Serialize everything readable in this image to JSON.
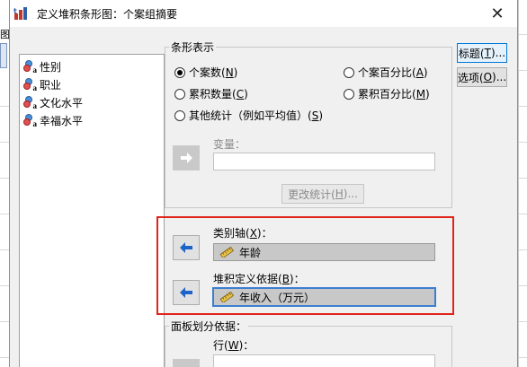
{
  "dialog": {
    "title": "定义堆积条形图：个案组摘要",
    "close_glyph": "✕"
  },
  "background_app": {
    "menu_fragment": "图"
  },
  "variables": [
    {
      "name": "性别",
      "icon": "nominal-variable-icon"
    },
    {
      "name": "职业",
      "icon": "nominal-variable-icon"
    },
    {
      "name": "文化水平",
      "icon": "nominal-variable-icon"
    },
    {
      "name": "幸福水平",
      "icon": "nominal-variable-icon"
    }
  ],
  "bars_represent": {
    "group_label": "条形表示",
    "options": [
      {
        "label": "个案数(",
        "key": "N",
        "suffix": ")",
        "checked": true
      },
      {
        "label": "个案百分比(",
        "key": "A",
        "suffix": ")",
        "checked": false
      },
      {
        "label": "累积数量(",
        "key": "C",
        "suffix": ")",
        "checked": false
      },
      {
        "label": "累积百分比(",
        "key": "M",
        "suffix": ")",
        "checked": false
      },
      {
        "label": "其他统计（例如平均值）(",
        "key": "S",
        "suffix": ")",
        "checked": false
      }
    ],
    "variable_label": "变量：",
    "variable_value": "",
    "change_stat": {
      "label": "更改统计(",
      "key": "H",
      "suffix": ")..."
    }
  },
  "category_axis": {
    "label": "类别轴(",
    "key": "X",
    "suffix": ")：",
    "value": "年龄"
  },
  "stack_by": {
    "label": "堆积定义依据(",
    "key": "B",
    "suffix": ")：",
    "value": "年收入（万元）"
  },
  "panel_by": {
    "group_label": "面板划分依据：",
    "rows_label": "行(",
    "rows_key": "W",
    "rows_suffix": ")："
  },
  "side_buttons": [
    {
      "label": "标题(",
      "key": "T",
      "suffix": ")..."
    },
    {
      "label": "选项(",
      "key": "O",
      "suffix": ")..."
    }
  ],
  "colors": {
    "highlight": "#e0231b",
    "focus_border": "#3c7fd0",
    "arrow_blue": "#1e64c8"
  }
}
